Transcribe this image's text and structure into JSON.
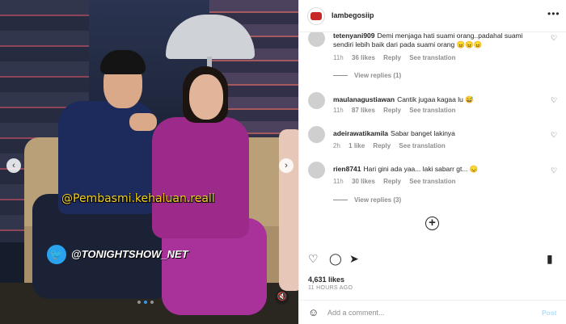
{
  "media": {
    "overlay_handle": "@Pembasmi.kehaluan.reall",
    "twitter_handle": "@TONIGHTSHOW_NET",
    "slide_count": 3,
    "active_slide": 2
  },
  "header": {
    "username": "lambegosiip",
    "more_icon": "more-horizontal-icon"
  },
  "comments": [
    {
      "username": "tetenyani909",
      "text": "Demi menjaga hati suami orang..padahal suami sendiri lebih baik dari pada suami orang 😠😠😠",
      "time": "11h",
      "likes": "36 likes",
      "reply_label": "Reply",
      "translate_label": "See translation",
      "replies_label": "View replies (1)"
    },
    {
      "username": "maulanagustiawan",
      "text": "Cantik jugaa kagaa lu 😅",
      "time": "11h",
      "likes": "87 likes",
      "reply_label": "Reply",
      "translate_label": "See translation"
    },
    {
      "username": "adeirawatikamila",
      "text": "Sabar banget lakinya",
      "time": "2h",
      "likes": "1 like",
      "reply_label": "Reply",
      "translate_label": "See translation"
    },
    {
      "username": "rien8741",
      "text": "Hari gini ada yaa... laki sabarr gt... 😞",
      "time": "11h",
      "likes": "30 likes",
      "reply_label": "Reply",
      "translate_label": "See translation",
      "replies_label": "View replies (3)"
    }
  ],
  "post": {
    "likes": "4,631 likes",
    "time_ago": "11 HOURS AGO"
  },
  "composer": {
    "placeholder": "Add a comment...",
    "post_label": "Post"
  },
  "colors": {
    "link_blue": "#3897f0",
    "muted": "#8e8e8e",
    "post_disabled": "#b2dffc",
    "twitter": "#2aa3ef",
    "handle_yellow": "#f4d21c"
  }
}
